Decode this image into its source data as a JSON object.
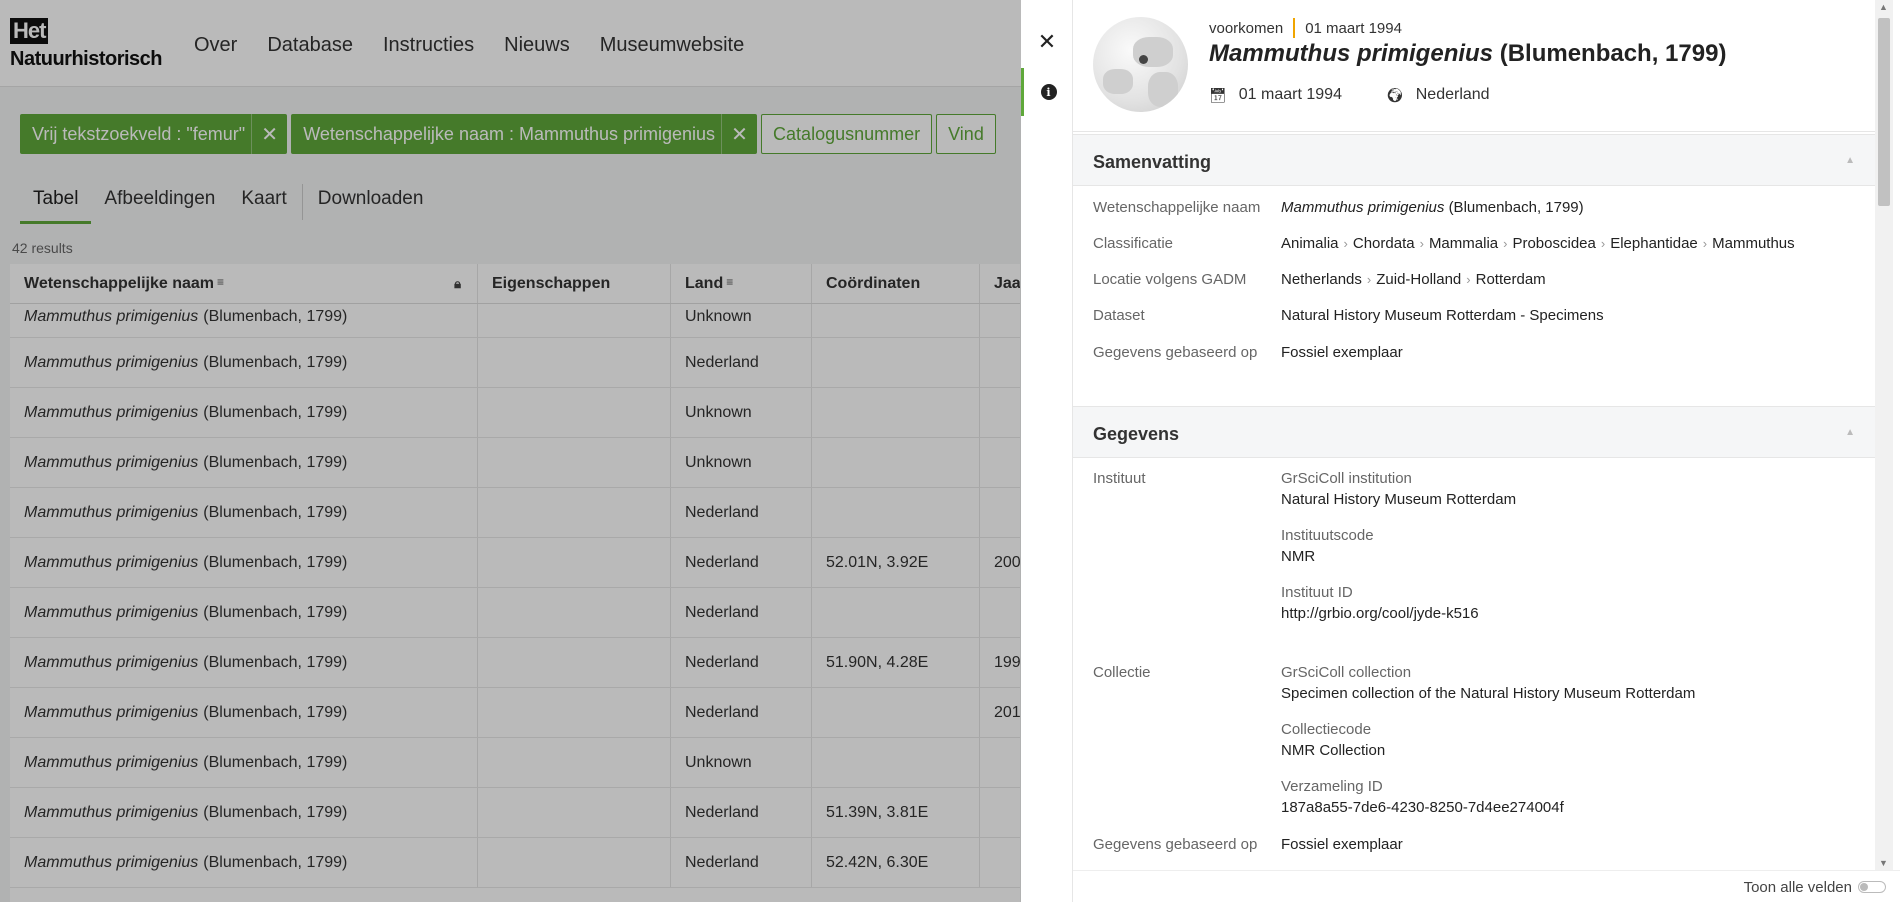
{
  "logo": {
    "line1": "Het",
    "line2": "Natuurhistorisch"
  },
  "nav": [
    "Over",
    "Database",
    "Instructies",
    "Nieuws",
    "Museumwebsite"
  ],
  "filters": {
    "chips": [
      {
        "label": "Vrij tekstzoekveld : \"femur\"",
        "removable": true
      },
      {
        "label": "Wetenschappelijke naam : Mammuthus primigenius",
        "removable": true
      }
    ],
    "outline_chips": [
      "Catalogusnummer",
      "Vind"
    ],
    "remove_glyph": "✕"
  },
  "tabs": [
    "Tabel",
    "Afbeeldingen",
    "Kaart",
    "Downloaden"
  ],
  "results": "42 results",
  "table": {
    "columns": [
      "Wetenschappelijke naam",
      "Eigenschappen",
      "Land",
      "Coördinaten",
      "Jaa"
    ],
    "rows": [
      {
        "sci": "Mammuthus primigenius",
        "author": "(Blumenbach, 1799)",
        "props": "",
        "land": "Unknown",
        "coords": "",
        "year": ""
      },
      {
        "sci": "Mammuthus primigenius",
        "author": "(Blumenbach, 1799)",
        "props": "",
        "land": "Nederland",
        "coords": "",
        "year": ""
      },
      {
        "sci": "Mammuthus primigenius",
        "author": "(Blumenbach, 1799)",
        "props": "",
        "land": "Unknown",
        "coords": "",
        "year": ""
      },
      {
        "sci": "Mammuthus primigenius",
        "author": "(Blumenbach, 1799)",
        "props": "",
        "land": "Unknown",
        "coords": "",
        "year": ""
      },
      {
        "sci": "Mammuthus primigenius",
        "author": "(Blumenbach, 1799)",
        "props": "",
        "land": "Nederland",
        "coords": "",
        "year": ""
      },
      {
        "sci": "Mammuthus primigenius",
        "author": "(Blumenbach, 1799)",
        "props": "",
        "land": "Nederland",
        "coords": "52.01N, 3.92E",
        "year": "200"
      },
      {
        "sci": "Mammuthus primigenius",
        "author": "(Blumenbach, 1799)",
        "props": "",
        "land": "Nederland",
        "coords": "",
        "year": ""
      },
      {
        "sci": "Mammuthus primigenius",
        "author": "(Blumenbach, 1799)",
        "props": "",
        "land": "Nederland",
        "coords": "51.90N, 4.28E",
        "year": "199"
      },
      {
        "sci": "Mammuthus primigenius",
        "author": "(Blumenbach, 1799)",
        "props": "",
        "land": "Nederland",
        "coords": "",
        "year": "201"
      },
      {
        "sci": "Mammuthus primigenius",
        "author": "(Blumenbach, 1799)",
        "props": "",
        "land": "Unknown",
        "coords": "",
        "year": ""
      },
      {
        "sci": "Mammuthus primigenius",
        "author": "(Blumenbach, 1799)",
        "props": "",
        "land": "Nederland",
        "coords": "51.39N, 3.81E",
        "year": ""
      },
      {
        "sci": "Mammuthus primigenius",
        "author": "(Blumenbach, 1799)",
        "props": "",
        "land": "Nederland",
        "coords": "52.42N, 6.30E",
        "year": ""
      }
    ]
  },
  "drawer": {
    "close_glyph": "✕",
    "info_glyph": "i",
    "header": {
      "type": "voorkomen",
      "date": "01 maart 1994",
      "title_italic": "Mammuthus primigenius",
      "title_author": "(Blumenbach, 1799)",
      "event_date": "01 maart 1994",
      "country": "Nederland"
    },
    "summary": {
      "title": "Samenvatting",
      "sci_label": "Wetenschappelijke naam",
      "sci_italic": "Mammuthus primigenius",
      "sci_author": "(Blumenbach, 1799)",
      "class_label": "Classificatie",
      "classification": [
        "Animalia",
        "Chordata",
        "Mammalia",
        "Proboscidea",
        "Elephantidae",
        "Mammuthus"
      ],
      "loc_label": "Locatie volgens GADM",
      "location": [
        "Netherlands",
        "Zuid-Holland",
        "Rotterdam"
      ],
      "dataset_label": "Dataset",
      "dataset": "Natural History Museum Rotterdam - Specimens",
      "basis_label": "Gegevens gebaseerd op",
      "basis": "Fossiel exemplaar"
    },
    "data": {
      "title": "Gegevens",
      "institute_label": "Instituut",
      "grsci_inst_label": "GrSciColl institution",
      "grsci_inst": "Natural History Museum Rotterdam",
      "inst_code_label": "Instituutscode",
      "inst_code": "NMR",
      "inst_id_label": "Instituut ID",
      "inst_id": "http://grbio.org/cool/jyde-k516",
      "collection_label": "Collectie",
      "grsci_coll_label": "GrSciColl collection",
      "grsci_coll": "Specimen collection of the Natural History Museum Rotterdam",
      "coll_code_label": "Collectiecode",
      "coll_code": "NMR Collection",
      "verz_id_label": "Verzameling ID",
      "verz_id": "187a8a55-7de6-4230-8250-7d4ee274004f",
      "basis_label": "Gegevens gebaseerd op",
      "basis": "Fossiel exemplaar"
    },
    "toggle_label": "Toon alle velden"
  },
  "colors": {
    "accent": "#5fa83a",
    "highlight_bar": "#f0a500"
  }
}
